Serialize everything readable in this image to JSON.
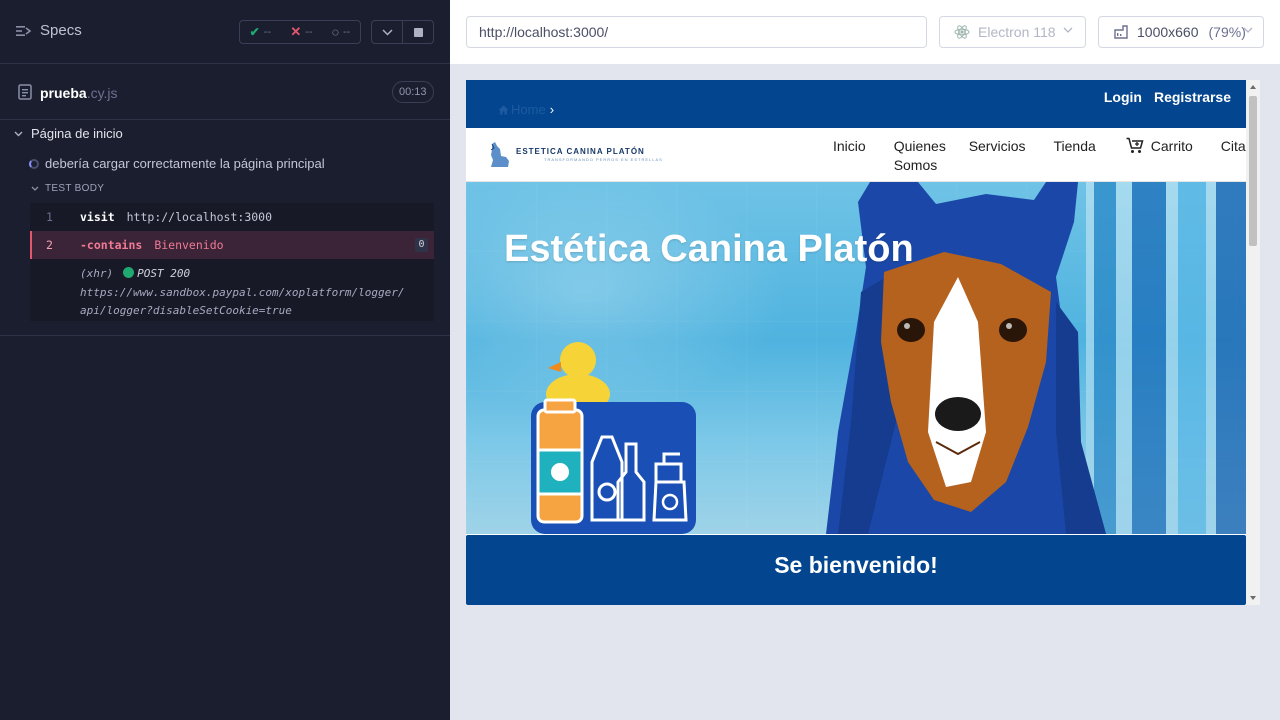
{
  "runner": {
    "specs_label": "Specs",
    "stats": {
      "passed": "--",
      "failed": "--",
      "pending": "--"
    },
    "file": {
      "name": "prueba",
      "ext": ".cy.js",
      "duration": "00:13"
    },
    "suite_title": "Página de inicio",
    "test_title": "debería cargar correctamente la página principal",
    "test_body_label": "TEST BODY",
    "commands": [
      {
        "num": "1",
        "name": "visit",
        "arg": "http://localhost:3000"
      },
      {
        "num": "2",
        "name": "-contains",
        "arg": "Bienvenido",
        "badge": "0"
      }
    ],
    "xhr": {
      "label": "(xhr)",
      "status": "POST 200",
      "url_line1": "https://www.sandbox.paypal.com/xoplatform/logger/",
      "url_line2": "api/logger?disableSetCookie=true"
    }
  },
  "aut": {
    "url": "http://localhost:3000/",
    "browser": "Electron 118",
    "viewport": "1000x660",
    "zoom": "(79%)"
  },
  "site": {
    "breadcrumb": "Home",
    "top_links": [
      "Login",
      "Registrarse"
    ],
    "logo_line1": "ESTETICA CANINA PLATÓN",
    "logo_line2": "TRANSFORMANDO PERROS EN ESTRELLAS",
    "nav": {
      "inicio": "Inicio",
      "quienes": "Quienes Somos",
      "servicios": "Servicios",
      "tienda": "Tienda",
      "carrito": "Carrito",
      "citas": "Citas"
    },
    "hero_title": "Estética Canina Platón",
    "welcome": "Se bienvenido!"
  },
  "colors": {
    "runner_bg": "#1b1e2e",
    "site_blue": "#03468f",
    "pass_green": "#1fa971",
    "fail_red": "#e45770"
  },
  "icons": [
    "specs-icon",
    "check-icon",
    "x-icon",
    "pending-icon",
    "chevron-down-icon",
    "stop-icon",
    "file-icon",
    "electron-icon",
    "viewport-icon",
    "home-icon",
    "cart-icon"
  ]
}
